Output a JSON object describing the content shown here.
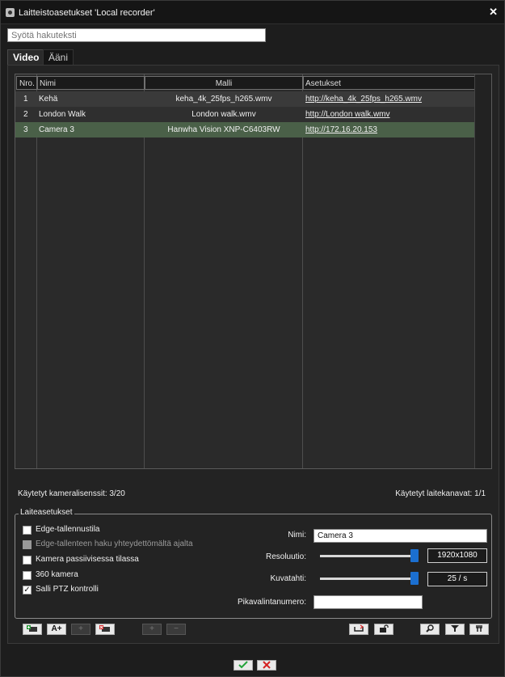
{
  "window": {
    "title": "Laitteistoasetukset 'Local recorder'",
    "close_glyph": "✕"
  },
  "search": {
    "placeholder": "Syötä hakuteksti"
  },
  "tabs": [
    {
      "label": "Video"
    },
    {
      "label": "Ääni"
    }
  ],
  "table": {
    "headers": [
      "Nro.",
      "Nimi",
      "Malli",
      "Asetukset"
    ],
    "rows": [
      {
        "nro": "1",
        "nimi": "Kehä",
        "malli": "keha_4k_25fps_h265.wmv",
        "asetukset": "http://keha_4k_25fps_h265.wmv",
        "selected": false
      },
      {
        "nro": "2",
        "nimi": "London Walk",
        "malli": "London walk.wmv",
        "asetukset": "http://London walk.wmv",
        "selected": false
      },
      {
        "nro": "3",
        "nimi": "Camera 3",
        "malli": "Hanwha Vision XNP-C6403RW",
        "asetukset": "http://172.16.20.153",
        "selected": true
      }
    ]
  },
  "status": {
    "camera_licenses": "Käytetyt kameralisenssit: 3/20",
    "device_channels": "Käytetyt laitekanavat: 1/1"
  },
  "settings": {
    "legend": "Laiteasetukset",
    "checkboxes": [
      {
        "label": "Edge-tallennustila",
        "checked": false,
        "enabled": true
      },
      {
        "label": "Edge-tallenteen haku yhteydettömältä ajalta",
        "checked": false,
        "enabled": false
      },
      {
        "label": "Kamera passiivisessa tilassa",
        "checked": false,
        "enabled": true
      },
      {
        "label": "360 kamera",
        "checked": false,
        "enabled": true
      },
      {
        "label": "Salli PTZ kontrolli",
        "checked": true,
        "enabled": true
      }
    ],
    "name_label": "Nimi:",
    "name_value": "Camera 3",
    "resolution_label": "Resoluutio:",
    "resolution_value": "1920x1080",
    "resolution_slider_fraction": 1.0,
    "framerate_label": "Kuvatahti:",
    "framerate_value": "25 / s",
    "framerate_slider_fraction": 1.0,
    "shortcut_label": "Pikavalintanumero:",
    "shortcut_value": ""
  },
  "toolbar": [
    {
      "name": "add-camera-button",
      "icon": "add-camera-icon",
      "enabled": true
    },
    {
      "name": "add-text-button",
      "icon": "A+",
      "enabled": true
    },
    {
      "name": "add-button",
      "icon": "+",
      "enabled": false
    },
    {
      "name": "remove-camera-button",
      "icon": "remove-camera-icon",
      "enabled": true
    },
    {
      "name": "add-item-button",
      "icon": "+",
      "enabled": false
    },
    {
      "name": "remove-item-button",
      "icon": "−",
      "enabled": false
    },
    {
      "name": "reconnect-button",
      "icon": "reconnect-icon",
      "enabled": true
    },
    {
      "name": "unlock-button",
      "icon": "unlock-icon",
      "enabled": true
    },
    {
      "name": "search-button",
      "icon": "search-icon",
      "enabled": true
    },
    {
      "name": "filter-button",
      "icon": "filter-icon",
      "enabled": true
    },
    {
      "name": "settings-button",
      "icon": "wrench-icon",
      "enabled": true
    }
  ],
  "dialog_buttons": {
    "ok": {
      "icon": "checkmark-icon",
      "color": "#22a33a"
    },
    "cancel": {
      "icon": "cross-icon",
      "color": "#d42020"
    }
  },
  "colors": {
    "selected_row": "#4a6048",
    "slider_thumb": "#1b6fd0",
    "link": "#ffffff"
  }
}
